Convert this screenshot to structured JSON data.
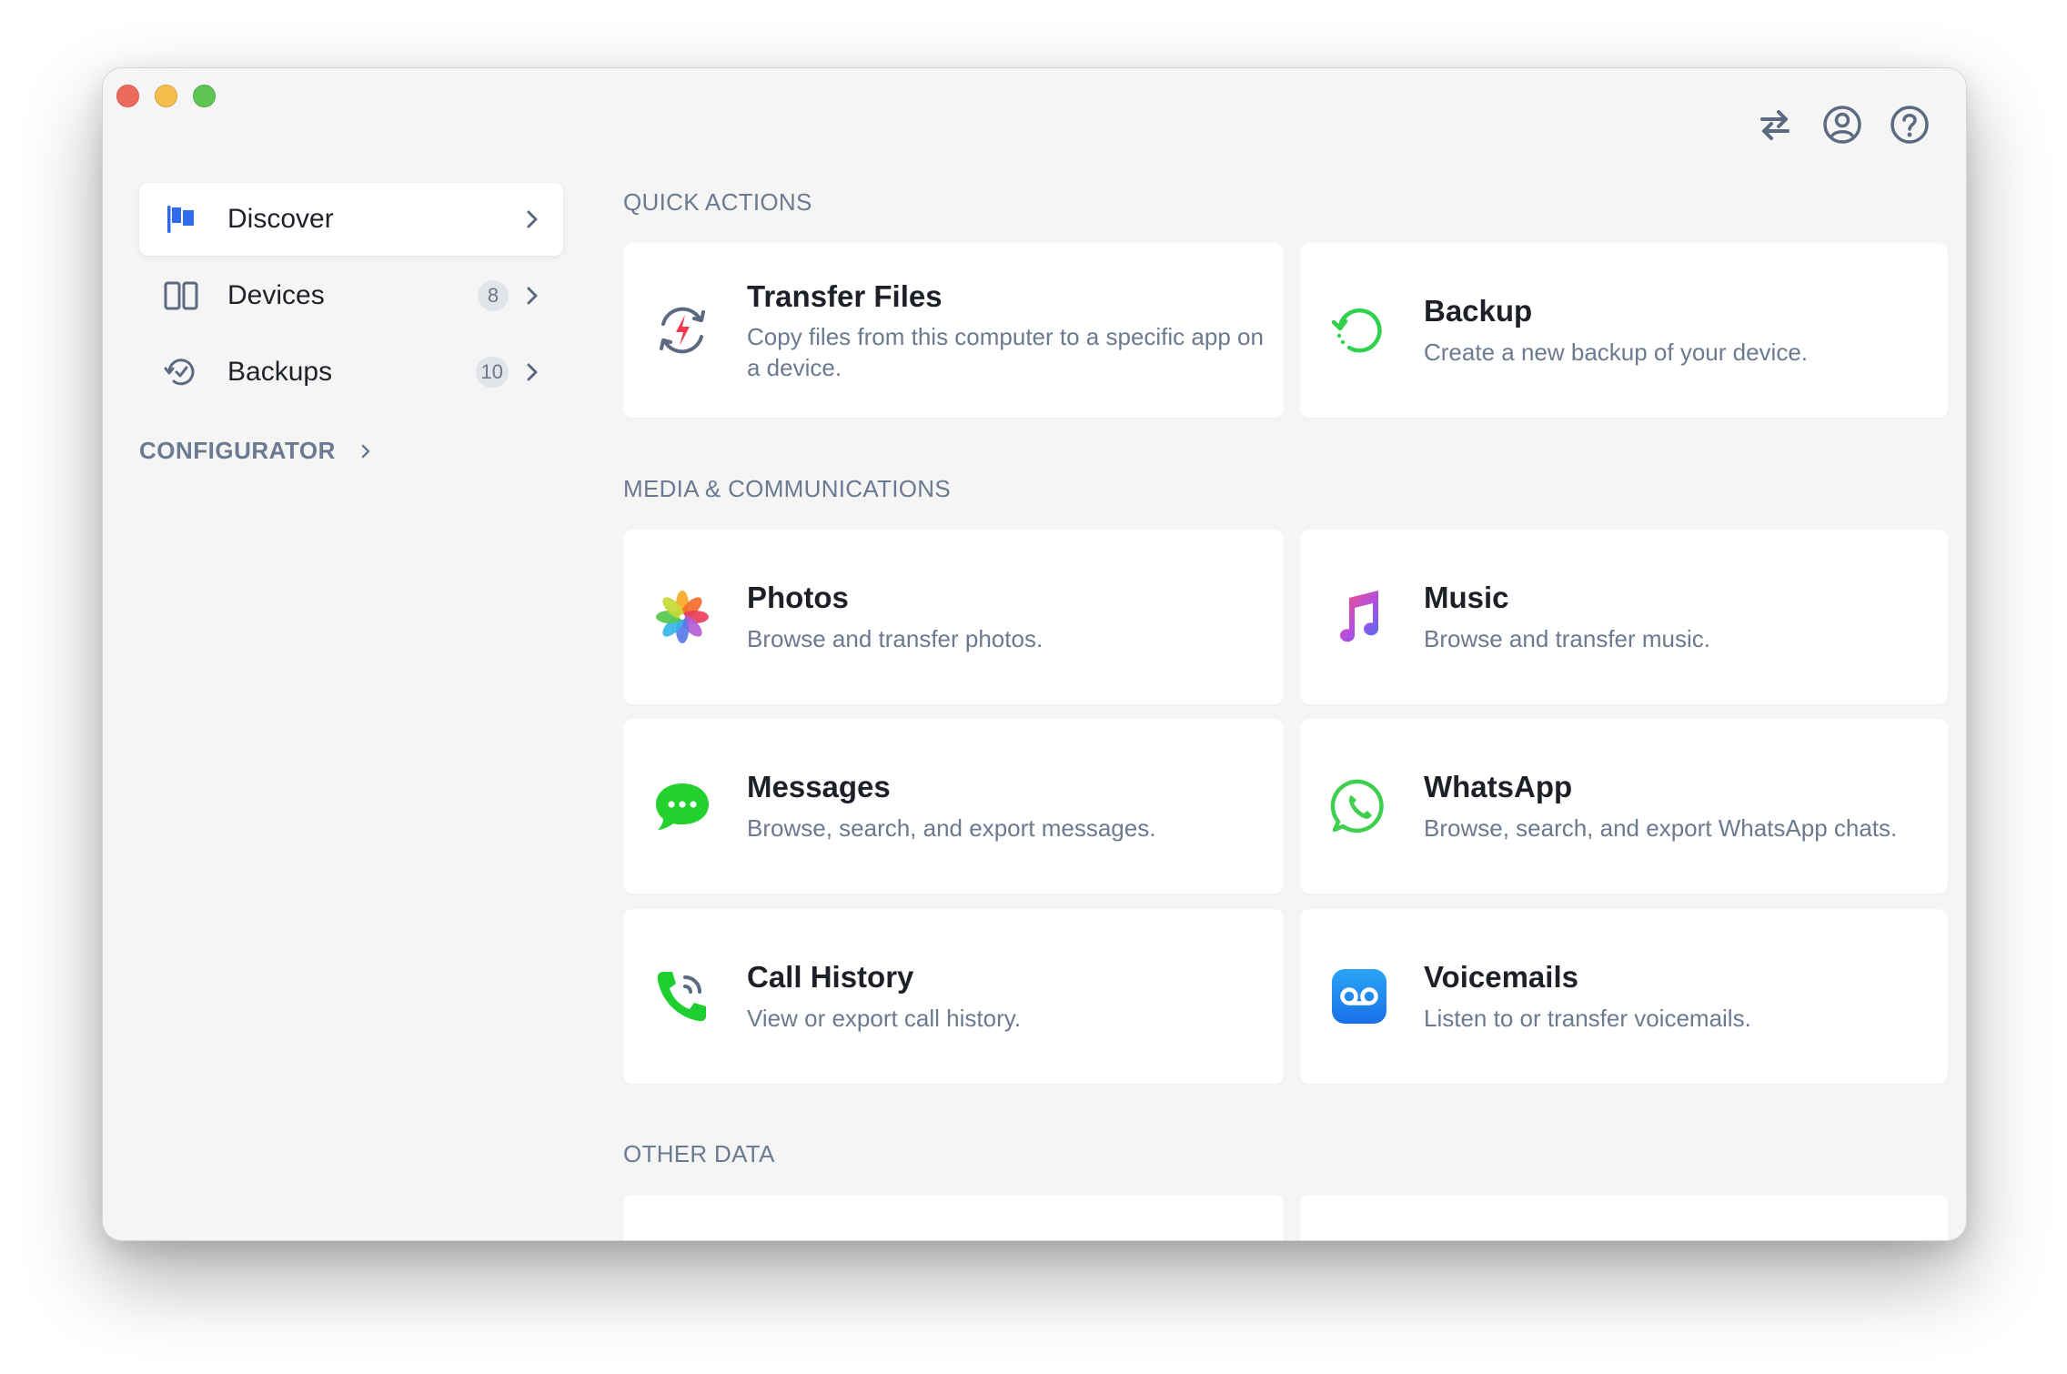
{
  "window": {
    "toolbar": {
      "transfer_icon": "arrows-exchange-icon",
      "account_icon": "user-circle-icon",
      "help_icon": "question-circle-icon"
    }
  },
  "sidebar": {
    "items": [
      {
        "label": "Discover",
        "icon": "flags-icon",
        "badge": "",
        "active": true
      },
      {
        "label": "Devices",
        "icon": "devices-icon",
        "badge": "8",
        "active": false
      },
      {
        "label": "Backups",
        "icon": "backup-clock-icon",
        "badge": "10",
        "active": false
      }
    ],
    "section": {
      "label": "CONFIGURATOR"
    }
  },
  "main": {
    "sections": [
      {
        "title": "QUICK ACTIONS",
        "cards": [
          {
            "title": "Transfer Files",
            "desc": "Copy files from this computer to a specific app on a device.",
            "icon": "transfer-files-icon"
          },
          {
            "title": "Backup",
            "desc": "Create a new backup of your device.",
            "icon": "backup-icon"
          }
        ]
      },
      {
        "title": "MEDIA & COMMUNICATIONS",
        "cards": [
          {
            "title": "Photos",
            "desc": "Browse and transfer photos.",
            "icon": "photos-icon"
          },
          {
            "title": "Music",
            "desc": "Browse and transfer music.",
            "icon": "music-icon"
          },
          {
            "title": "Messages",
            "desc": "Browse, search, and export messages.",
            "icon": "messages-icon"
          },
          {
            "title": "WhatsApp",
            "desc": "Browse, search, and export WhatsApp chats.",
            "icon": "whatsapp-icon"
          },
          {
            "title": "Call History",
            "desc": "View or export call history.",
            "icon": "phone-icon"
          },
          {
            "title": "Voicemails",
            "desc": "Listen to or transfer voicemails.",
            "icon": "voicemail-icon"
          }
        ]
      },
      {
        "title": "OTHER DATA",
        "cards": []
      }
    ]
  },
  "colors": {
    "accent": "#2f6bec",
    "backup_green": "#2fd14c",
    "messages_green": "#23d12d",
    "voicemail_blue": "#1e86f0",
    "section_text": "#6b7a90"
  }
}
